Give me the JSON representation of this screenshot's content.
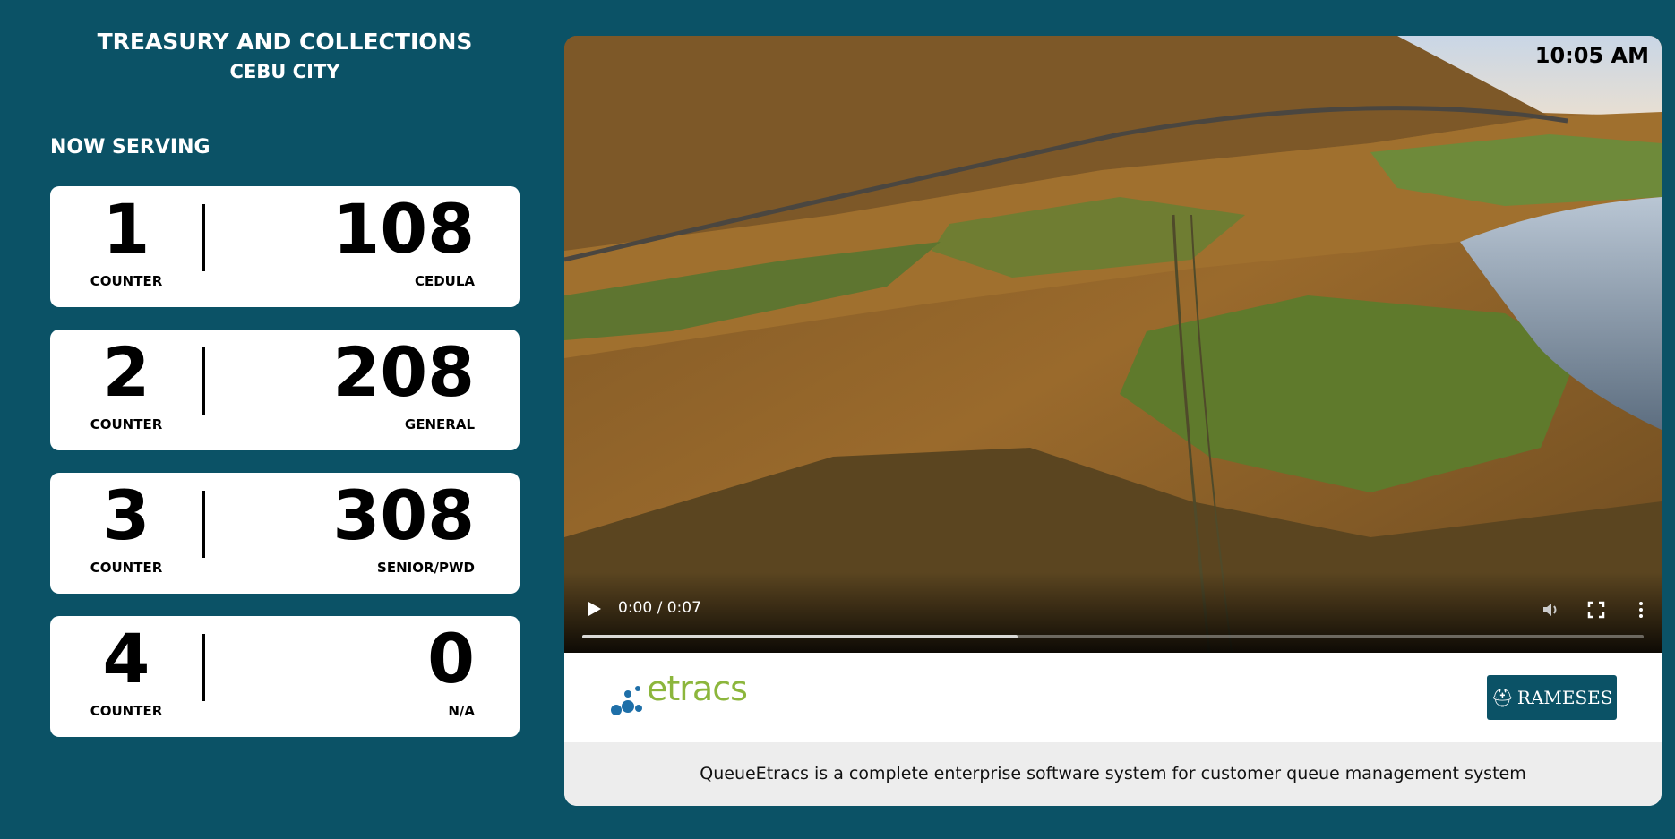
{
  "header": {
    "title": "TREASURY AND COLLECTIONS",
    "subtitle": "CEBU CITY"
  },
  "now_serving_label": "NOW SERVING",
  "counters": [
    {
      "counter": "1",
      "counter_label": "COUNTER",
      "ticket": "108",
      "category": "CEDULA"
    },
    {
      "counter": "2",
      "counter_label": "COUNTER",
      "ticket": "208",
      "category": "GENERAL"
    },
    {
      "counter": "3",
      "counter_label": "COUNTER",
      "ticket": "308",
      "category": "SENIOR/PWD"
    },
    {
      "counter": "4",
      "counter_label": "COUNTER",
      "ticket": "0",
      "category": "N/A"
    }
  ],
  "clock": "10:05 AM",
  "video": {
    "time": "0:00 / 0:07",
    "progress": 0.41
  },
  "branding": {
    "etracs": "etracs",
    "rameses": "RAMESES"
  },
  "footer_text": "QueueEtracs is a complete enterprise software system for customer queue management system",
  "colors": {
    "background": "#0b5266",
    "card": "#ffffff",
    "etracs_green": "#8cb63c",
    "etracs_blue": "#1e6fa8"
  }
}
